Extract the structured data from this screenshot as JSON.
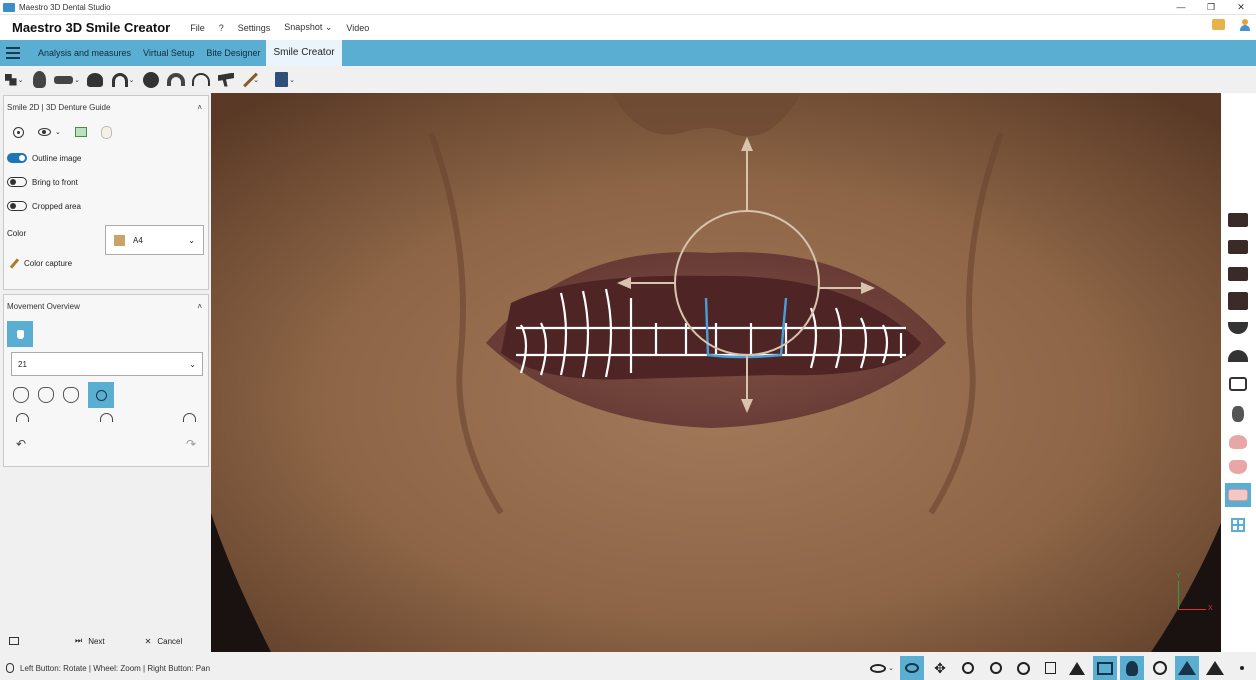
{
  "window": {
    "title": "Maestro 3D Dental Studio",
    "controls": [
      "—",
      "❐",
      "✕"
    ]
  },
  "menubar": {
    "brand": "Maestro 3D Smile Creator",
    "items": [
      "File",
      "?",
      "Settings",
      "Snapshot",
      "Video"
    ],
    "snapshot_arrow": "⌄"
  },
  "ribbon": {
    "tabs": [
      "Analysis and measures",
      "Virtual Setup",
      "Bite Designer",
      "Smile Creator"
    ],
    "active": "Smile Creator"
  },
  "toolbar": {
    "icons": [
      "boxes-icon",
      "head-icon",
      "teeth-row-icon",
      "skull-icon",
      "arch-icon",
      "rotate-model-icon",
      "arch-outline-icon",
      "arch-outline-icon-2",
      "articulator-icon",
      "brush-icon",
      "book-icon"
    ]
  },
  "smile_panel": {
    "title": "Smile 2D | 3D Denture Guide",
    "options": [
      {
        "label": "Outline image",
        "on": true
      },
      {
        "label": "Bring to front",
        "on": false
      },
      {
        "label": "Cropped area",
        "on": false
      }
    ],
    "color_label": "Color",
    "color_value": "A4",
    "color_swatch": "#c9a36a",
    "color_capture": "Color capture"
  },
  "movement_panel": {
    "title": "Movement Overview",
    "tooth_value": "21"
  },
  "footer": {
    "next": "Next",
    "cancel": "Cancel"
  },
  "status": {
    "hint": "Left Button: Rotate | Wheel: Zoom | Right Button: Pan"
  },
  "axes": {
    "y": "Y",
    "x": "X"
  },
  "colors": {
    "accent": "#5aaed2",
    "toggle_on": "#1f75b6"
  }
}
